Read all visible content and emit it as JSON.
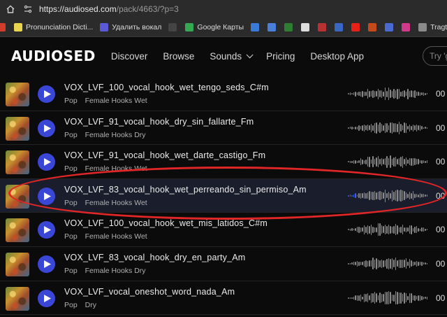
{
  "browser": {
    "url_host": "https://audiosed.com",
    "url_path": "/pack/4663/?p=3",
    "bookmarks": [
      {
        "label": "",
        "icon": "bookmark-red-icon",
        "color": "#d23c2a"
      },
      {
        "label": "Pronunciation Dicti...",
        "icon": "dictionary-icon",
        "color": "#e8d44d"
      },
      {
        "label": "Удалить вокал",
        "icon": "vocal-remover-icon",
        "color": "#5a5ad6"
      },
      {
        "label": "",
        "icon": "circle-icon",
        "color": "#444"
      },
      {
        "label": "Google Карты",
        "icon": "maps-icon",
        "color": "#34a853"
      },
      {
        "label": "",
        "icon": "wave-bookmark-icon",
        "color": "#3b7bd8"
      },
      {
        "label": "",
        "icon": "translate-icon",
        "color": "#4a7fd9"
      },
      {
        "label": "",
        "icon": "ua-icon",
        "color": "#2e7d32"
      },
      {
        "label": "",
        "icon": "plus-icon",
        "color": "#ddd"
      },
      {
        "label": "",
        "icon": "star-bookmark-icon",
        "color": "#b93232"
      },
      {
        "label": "",
        "icon": "audio-icon",
        "color": "#3a66c4"
      },
      {
        "label": "",
        "icon": "youtube-icon",
        "color": "#e62117"
      },
      {
        "label": "",
        "icon": "app-icon",
        "color": "#c44a1a"
      },
      {
        "label": "",
        "icon": "arrow-icon",
        "color": "#4a6ad1"
      },
      {
        "label": "",
        "icon": "puzzle-icon",
        "color": "#d13a8a"
      },
      {
        "label": "Tragtorr.in",
        "icon": "tragtorr-icon",
        "color": "#8a8a8a"
      },
      {
        "label": "",
        "icon": "tomato-icon",
        "color": "#d8342a"
      },
      {
        "label": "",
        "icon": "folder-icon",
        "color": "#888"
      }
    ]
  },
  "site": {
    "logo": "AUDIOSED",
    "nav": [
      {
        "label": "Discover",
        "dropdown": false
      },
      {
        "label": "Browse",
        "dropdown": false
      },
      {
        "label": "Sounds",
        "dropdown": true
      },
      {
        "label": "Pricing",
        "dropdown": false
      },
      {
        "label": "Desktop App",
        "dropdown": false
      }
    ],
    "search_placeholder": "Try 'g"
  },
  "tracks": [
    {
      "title": "VOX_LVF_100_vocal_hook_wet_tengo_seds_C#m",
      "genre": "Pop",
      "category": "Female Hooks Wet",
      "duration": "00",
      "highlighted": false,
      "progress": 0
    },
    {
      "title": "VOX_LVF_91_vocal_hook_dry_sin_fallarte_Fm",
      "genre": "Pop",
      "category": "Female Hooks Dry",
      "duration": "00",
      "highlighted": false,
      "progress": 0
    },
    {
      "title": "VOX_LVF_91_vocal_hook_wet_darte_castigo_Fm",
      "genre": "Pop",
      "category": "Female Hooks Wet",
      "duration": "00",
      "highlighted": false,
      "progress": 0
    },
    {
      "title": "VOX_LVF_83_vocal_hook_wet_perreando_sin_permiso_Am",
      "genre": "Pop",
      "category": "Female Hooks Wet",
      "duration": "00",
      "highlighted": true,
      "progress": 0.12
    },
    {
      "title": "VOX_LVF_100_vocal_hook_wet_mis_latidos_C#m",
      "genre": "Pop",
      "category": "Female Hooks Wet",
      "duration": "00",
      "highlighted": false,
      "progress": 0
    },
    {
      "title": "VOX_LVF_83_vocal_hook_dry_en_party_Am",
      "genre": "Pop",
      "category": "Female Hooks Dry",
      "duration": "00",
      "highlighted": false,
      "progress": 0
    },
    {
      "title": "VOX_LVF_vocal_oneshot_word_nada_Am",
      "genre": "Pop",
      "category": "Dry",
      "duration": "00",
      "highlighted": false,
      "progress": 0
    }
  ],
  "colors": {
    "accent": "#3a47d6",
    "annotation": "#e02626",
    "played": "#3d63e0"
  }
}
